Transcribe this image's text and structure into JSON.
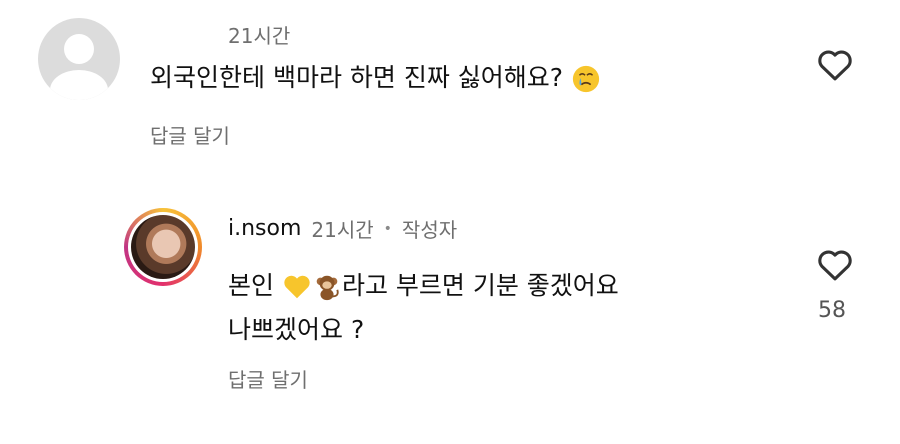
{
  "comments": [
    {
      "time": "21시간",
      "text_before_emoji": "외국인한테 백마라 하면 진짜 싫어해요?",
      "reply_label": "답글 달기"
    },
    {
      "username": "i.nsom",
      "time": "21시간",
      "separator": "•",
      "author_badge": "작성자",
      "line1_part1": "본인 ",
      "line1_part2": "라고 부르면 기분 좋겠어요",
      "line2": "나쁘겠어요 ?",
      "reply_label": "답글 달기",
      "likes": "58"
    }
  ],
  "icons": {
    "like": "heart-outline-icon",
    "crying_emoji": "crying-face-emoji",
    "heart_emoji": "yellow-heart-emoji",
    "monkey_emoji": "monkey-emoji"
  },
  "colors": {
    "yellow_heart": "#f7c52c",
    "ring_gradient_start": "#f7c23a",
    "ring_gradient_end": "#c13584"
  }
}
